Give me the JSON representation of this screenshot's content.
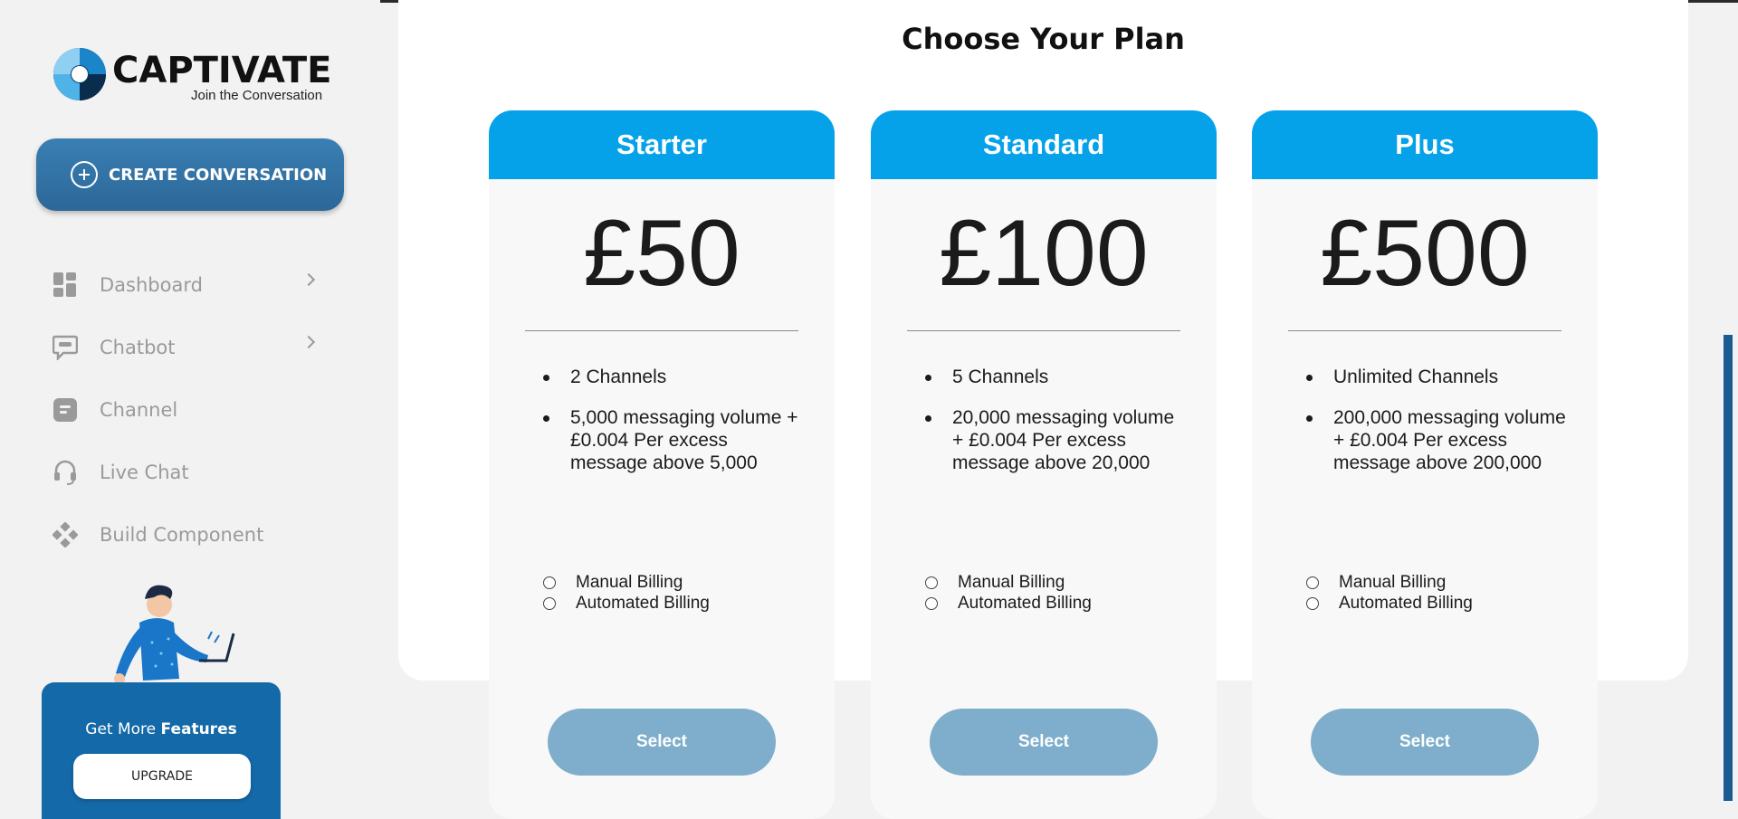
{
  "brand": {
    "name": "CAPTIVATE",
    "tagline": "Join the Conversation"
  },
  "sidebar": {
    "create_button": "CREATE CONVERSATION",
    "items": [
      {
        "label": "Dashboard",
        "icon": "dashboard-icon",
        "has_submenu": true
      },
      {
        "label": "Chatbot",
        "icon": "chatbot-icon",
        "has_submenu": true
      },
      {
        "label": "Channel",
        "icon": "channel-icon",
        "has_submenu": false
      },
      {
        "label": "Live Chat",
        "icon": "headset-icon",
        "has_submenu": false
      },
      {
        "label": "Build Component",
        "icon": "component-icon",
        "has_submenu": false
      }
    ],
    "promo": {
      "text": "Get More ",
      "text_bold": "Features",
      "button": "UPGRADE"
    }
  },
  "main": {
    "title": "Choose Your Plan",
    "plans": [
      {
        "name": "Starter",
        "price": "£50",
        "features": [
          "2 Channels",
          "5,000 messaging volume + £0.004 Per excess message above 5,000"
        ],
        "billing_options": [
          "Manual Billing",
          "Automated Billing"
        ],
        "select_label": "Select"
      },
      {
        "name": "Standard",
        "price": "£100",
        "features": [
          "5 Channels",
          "20,000 messaging volume + £0.004 Per excess message above 20,000"
        ],
        "billing_options": [
          "Manual Billing",
          "Automated Billing"
        ],
        "select_label": "Select"
      },
      {
        "name": "Plus",
        "price": "£500",
        "features": [
          "Unlimited Channels",
          "200,000 messaging volume + £0.004 Per excess message above 200,000"
        ],
        "billing_options": [
          "Manual Billing",
          "Automated Billing"
        ],
        "select_label": "Select"
      }
    ]
  },
  "colors": {
    "accent": "#05a2ea",
    "sidebar_button": "#2c6797",
    "select_button": "#7eaecb",
    "promo_bg": "#1469a8",
    "nav_text": "#9a9a9a"
  }
}
